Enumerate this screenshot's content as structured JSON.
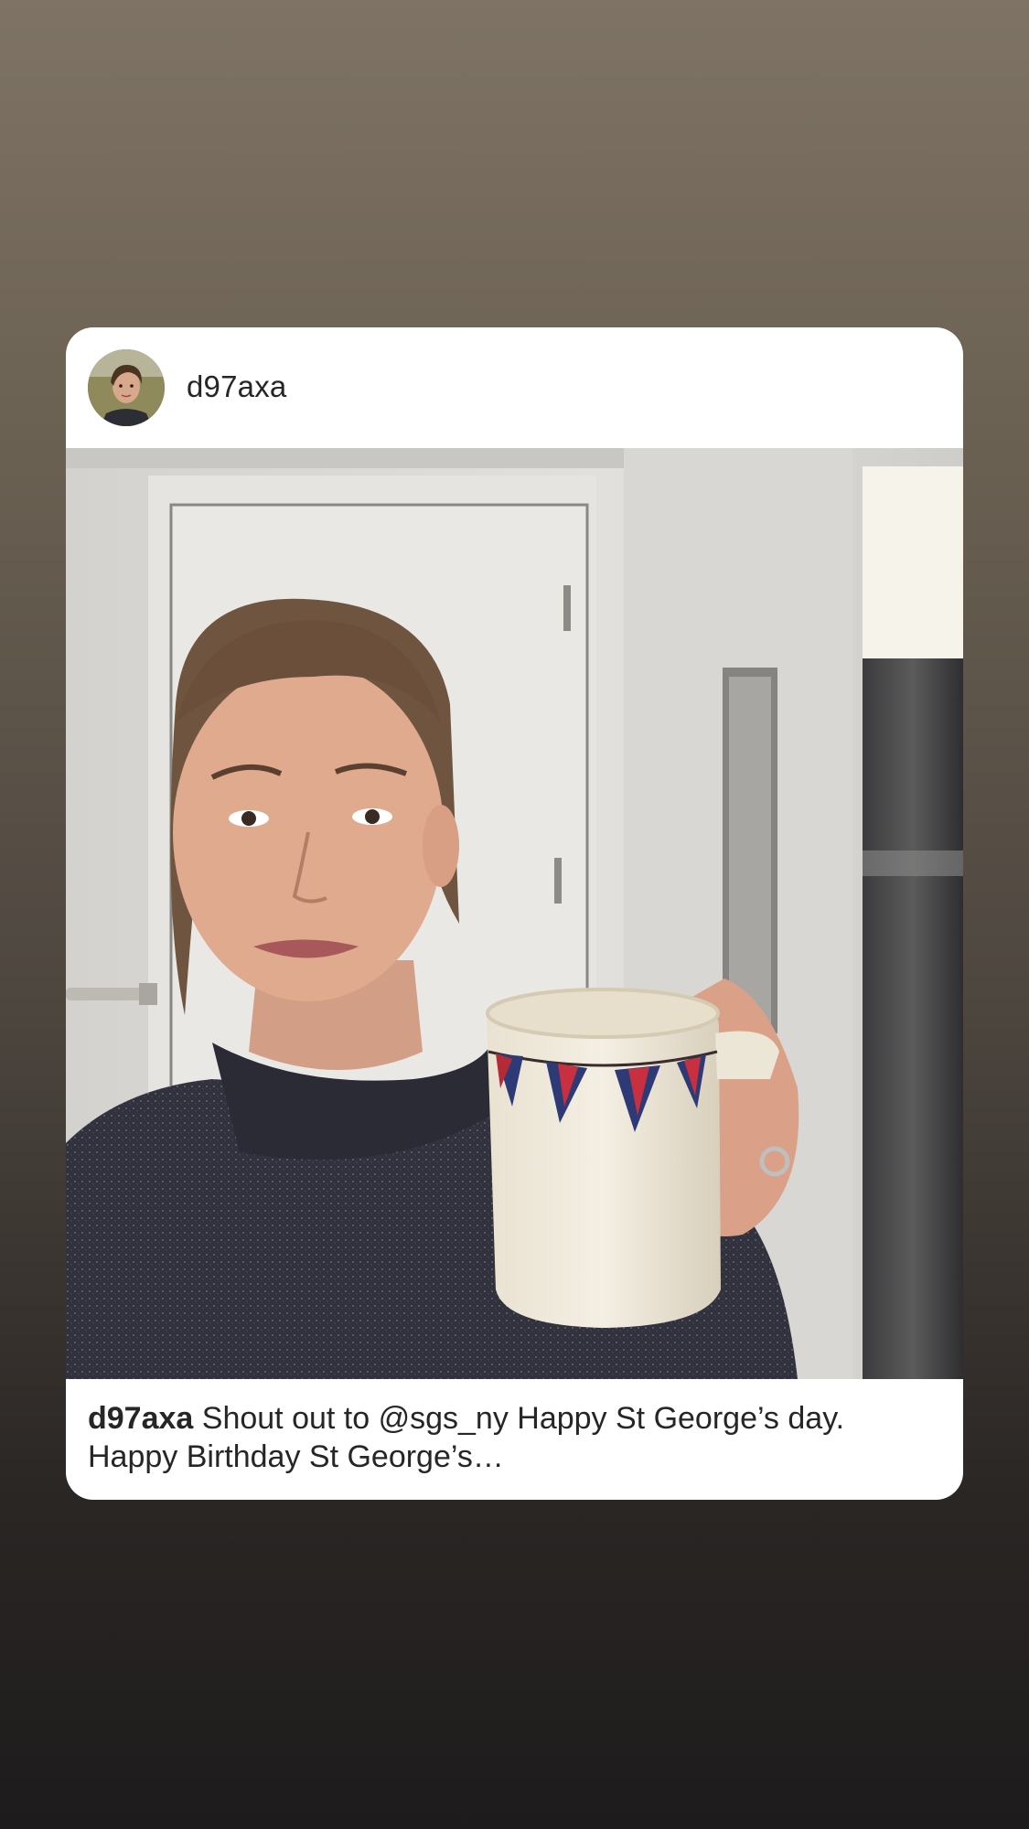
{
  "post": {
    "username": "d97axa",
    "caption_username": "d97axa",
    "caption_text": "Shout out to @sgs_ny Happy St George’s day. Happy Birthday St George’s…"
  },
  "icons": {
    "avatar": "profile-photo",
    "photo": "woman-holding-union-jack-mug"
  }
}
